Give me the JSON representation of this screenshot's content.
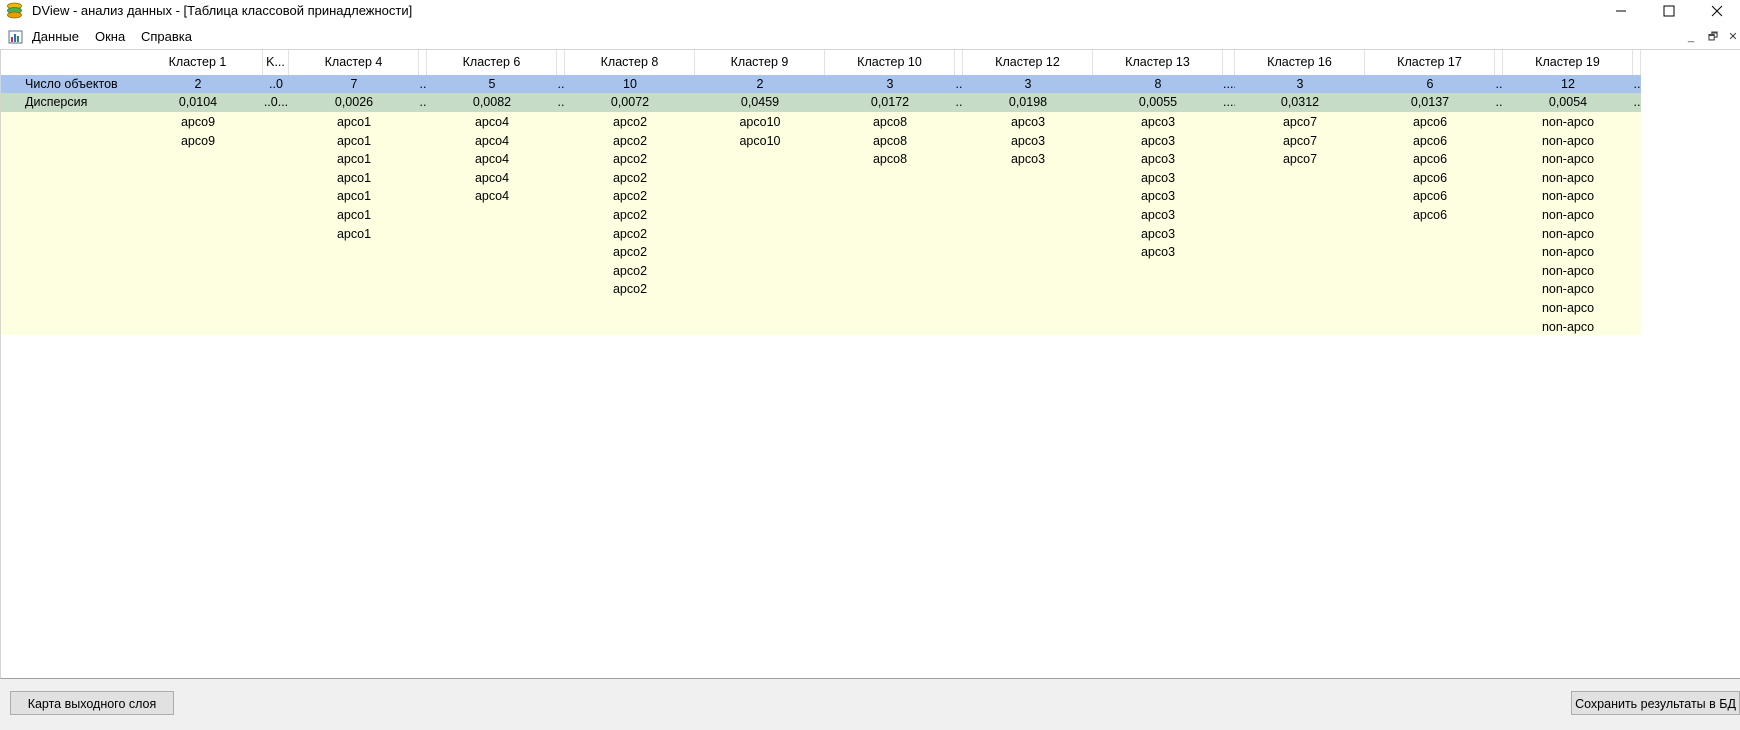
{
  "window": {
    "title": "DView - анализ данных - [Таблица классовой принадлежности]",
    "minimize": "─",
    "maximize": "☐",
    "close": "✕"
  },
  "menu": {
    "items": [
      {
        "label": "Данные"
      },
      {
        "label": "Окна"
      },
      {
        "label": "Справка"
      }
    ],
    "mdi": {
      "minimize": "_",
      "restore": "🗗",
      "close": "✕"
    }
  },
  "table": {
    "row_labels": {
      "count": "Число объектов",
      "dispersion": "Дисперсия"
    },
    "columns": [
      {
        "header": "Кластер 1",
        "count": "2",
        "dispersion": "0,0104",
        "items": [
          "apco9",
          "apco9"
        ]
      },
      {
        "header": "K...",
        "count": "..0",
        "dispersion": "..0...",
        "items": []
      },
      {
        "header": "Кластер 4",
        "count": "7",
        "dispersion": "0,0026",
        "items": [
          "apco1",
          "apco1",
          "apco1",
          "apco1",
          "apco1",
          "apco1",
          "apco1"
        ]
      },
      {
        "header": "",
        "count": "..",
        "dispersion": "..",
        "items": []
      },
      {
        "header": "Кластер 6",
        "count": "5",
        "dispersion": "0,0082",
        "items": [
          "apco4",
          "apco4",
          "apco4",
          "apco4",
          "apco4"
        ]
      },
      {
        "header": "",
        "count": "..",
        "dispersion": "..",
        "items": []
      },
      {
        "header": "Кластер 8",
        "count": "10",
        "dispersion": "0,0072",
        "items": [
          "apco2",
          "apco2",
          "apco2",
          "apco2",
          "apco2",
          "apco2",
          "apco2",
          "apco2",
          "apco2",
          "apco2"
        ]
      },
      {
        "header": "Кластер 9",
        "count": "2",
        "dispersion": "0,0459",
        "items": [
          "apco10",
          "apco10"
        ]
      },
      {
        "header": "Кластер 10",
        "count": "3",
        "dispersion": "0,0172",
        "items": [
          "apco8",
          "apco8",
          "apco8"
        ]
      },
      {
        "header": "",
        "count": "..",
        "dispersion": "..",
        "items": []
      },
      {
        "header": "Кластер 12",
        "count": "3",
        "dispersion": "0,0198",
        "items": [
          "apco3",
          "apco3",
          "apco3"
        ]
      },
      {
        "header": "Кластер 13",
        "count": "8",
        "dispersion": "0,0055",
        "items": [
          "apco3",
          "apco3",
          "apco3",
          "apco3",
          "apco3",
          "apco3",
          "apco3",
          "apco3"
        ]
      },
      {
        "header": "",
        "count": "....",
        "dispersion": "....",
        "items": []
      },
      {
        "header": "Кластер 16",
        "count": "3",
        "dispersion": "0,0312",
        "items": [
          "apco7",
          "apco7",
          "apco7"
        ]
      },
      {
        "header": "Кластер 17",
        "count": "6",
        "dispersion": "0,0137",
        "items": [
          "apco6",
          "apco6",
          "apco6",
          "apco6",
          "apco6",
          "apco6"
        ]
      },
      {
        "header": "",
        "count": "..",
        "dispersion": "..",
        "items": []
      },
      {
        "header": "Кластер 19",
        "count": "12",
        "dispersion": "0,0054",
        "items": [
          "non-apco",
          "non-apco",
          "non-apco",
          "non-apco",
          "non-apco",
          "non-apco",
          "non-apco",
          "non-apco",
          "non-apco",
          "non-apco",
          "non-apco",
          "non-apco"
        ]
      },
      {
        "header": "",
        "count": "..",
        "dispersion": "..",
        "items": []
      }
    ]
  },
  "buttons": {
    "output_map": "Карта выходного слоя",
    "save_db": "Сохранить результаты в БД"
  },
  "colors": {
    "count_row": "#a8c4ec",
    "dispersion_row": "#c6dcc6",
    "items_area": "#fefee1"
  }
}
